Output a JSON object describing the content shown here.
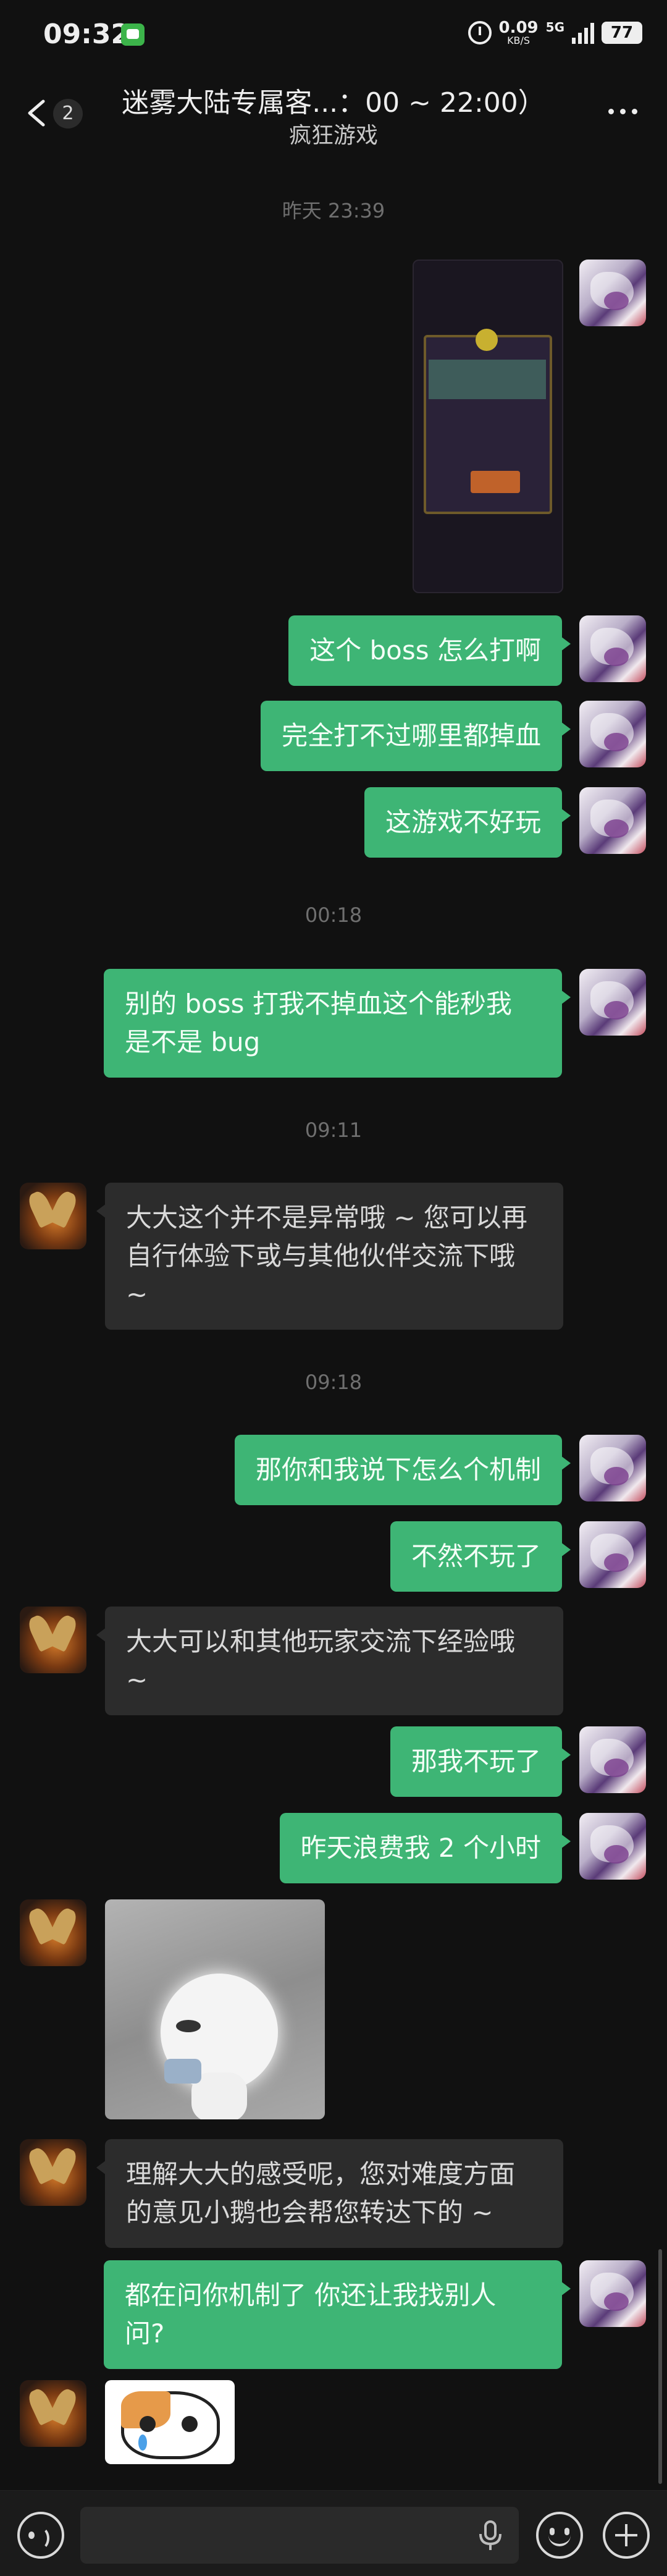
{
  "status_bar": {
    "time": "09:32",
    "speed_value": "0.09",
    "speed_unit": "KB/S",
    "network": "5G",
    "battery": "77"
  },
  "header": {
    "unread_count": "2",
    "title": "迷雾大陆专属客...：00 ~ 22:00）",
    "subtitle": "疯狂游戏"
  },
  "messages": {
    "ts1": "昨天 23:39",
    "m2": "这个 boss 怎么打啊",
    "m3": "完全打不过哪里都掉血",
    "m4": "这游戏不好玩",
    "ts2": "00:18",
    "m5_l1": "别的 boss 打我不掉血这个能秒我",
    "m5_l2": "是不是 bug",
    "ts3": "09:11",
    "m6_l1": "大大这个并不是异常哦 ~ 您可以再",
    "m6_l2": "自行体验下或与其他伙伴交流下哦",
    "m6_l3": "~",
    "ts4": "09:18",
    "m7": "那你和我说下怎么个机制",
    "m8": "不然不玩了",
    "m9_l1": "大大可以和其他玩家交流下经验哦",
    "m9_l2": "~",
    "m10": "那我不玩了",
    "m11": "昨天浪费我 2 个小时",
    "m13_l1": "理解大大的感受呢，您对难度方面",
    "m13_l2": "的意见小鹅也会帮您转达下的 ~",
    "m14_l1": "都在问你机制了  你还让我找别人",
    "m14_l2": "问?"
  },
  "input": {
    "placeholder": ""
  },
  "colors": {
    "self_bubble": "#3eb575",
    "other_bubble": "#2c2c2c",
    "background": "#111111"
  }
}
